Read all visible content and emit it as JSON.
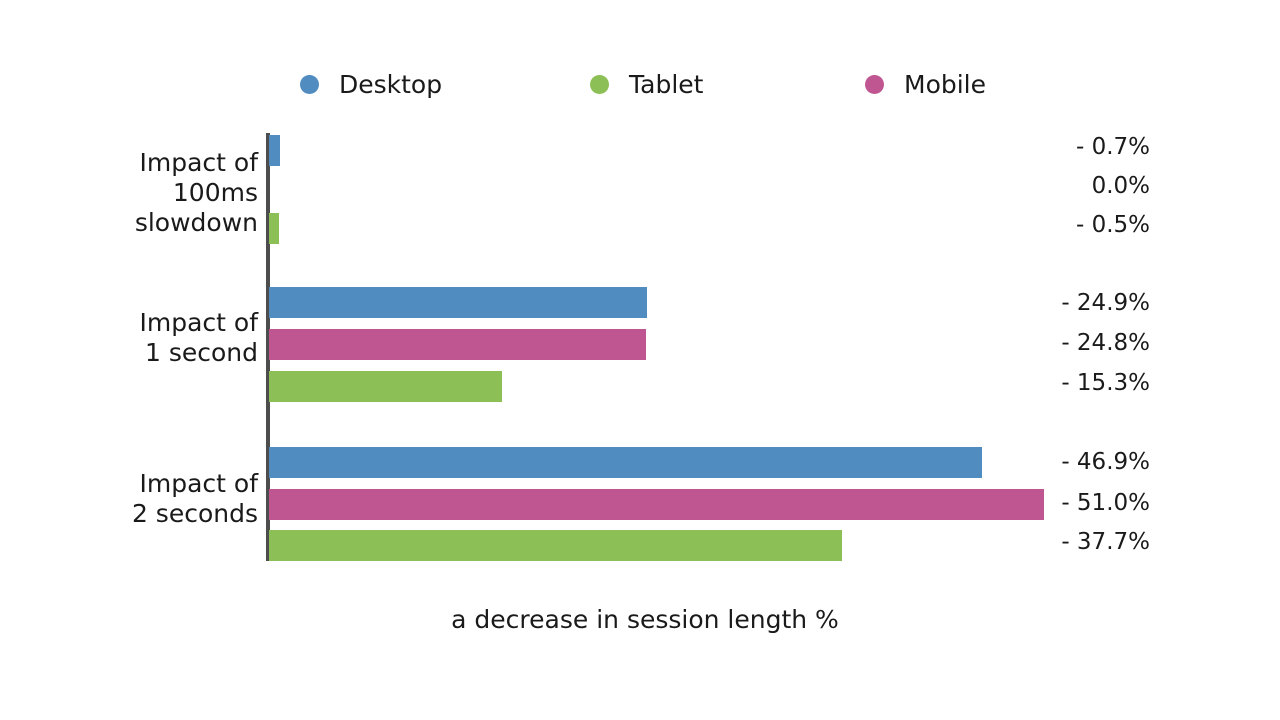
{
  "chart_data": {
    "type": "bar",
    "orientation": "horizontal",
    "title": "",
    "xlabel": "a decrease in session length %",
    "ylabel": "",
    "grid": false,
    "legend_position": "top",
    "xlim": [
      0,
      51
    ],
    "categories": [
      "Impact of\n100ms\nslowdown",
      "Impact of\n1 second",
      "Impact of\n2 seconds"
    ],
    "series": [
      {
        "name": "Desktop",
        "color": "#518CC0",
        "values": [
          -0.7,
          -24.9,
          -46.9
        ]
      },
      {
        "name": "Mobile",
        "color": "#C05691",
        "values": [
          0.0,
          -24.8,
          -51.0
        ]
      },
      {
        "name": "Tablet",
        "color": "#8CBF55",
        "values": [
          -0.5,
          -15.3,
          -37.7
        ]
      }
    ],
    "bar_order_in_group": [
      "Desktop",
      "Mobile",
      "Tablet"
    ],
    "data_labels": [
      [
        "- 0.7%",
        "0.0%",
        "- 0.5%"
      ],
      [
        "- 24.9%",
        "- 24.8%",
        "- 15.3%"
      ],
      [
        "- 46.9%",
        "- 51.0%",
        "- 37.7%"
      ]
    ],
    "axis_line_color": "#4d4d4d",
    "background": "#ffffff"
  },
  "legend": {
    "items": [
      {
        "label": "Desktop",
        "color": "#518CC0"
      },
      {
        "label": "Tablet",
        "color": "#8CBF55"
      },
      {
        "label": "Mobile",
        "color": "#C05691"
      }
    ]
  },
  "groups": [
    {
      "label": "Impact of\n100ms\nslowdown",
      "bars": [
        {
          "series": "Desktop",
          "value_label": "- 0.7%",
          "color": "#518CC0"
        },
        {
          "series": "Mobile",
          "value_label": "0.0%",
          "color": "#C05691"
        },
        {
          "series": "Tablet",
          "value_label": "- 0.5%",
          "color": "#8CBF55"
        }
      ]
    },
    {
      "label": "Impact of\n1 second",
      "bars": [
        {
          "series": "Desktop",
          "value_label": "- 24.9%",
          "color": "#518CC0"
        },
        {
          "series": "Mobile",
          "value_label": "- 24.8%",
          "color": "#C05691"
        },
        {
          "series": "Tablet",
          "value_label": "- 15.3%",
          "color": "#8CBF55"
        }
      ]
    },
    {
      "label": "Impact of\n2 seconds",
      "bars": [
        {
          "series": "Desktop",
          "value_label": "- 46.9%",
          "color": "#518CC0"
        },
        {
          "series": "Mobile",
          "value_label": "- 51.0%",
          "color": "#C05691"
        },
        {
          "series": "Tablet",
          "value_label": "- 37.7%",
          "color": "#8CBF55"
        }
      ]
    }
  ],
  "axis_title": "a decrease in session length %"
}
